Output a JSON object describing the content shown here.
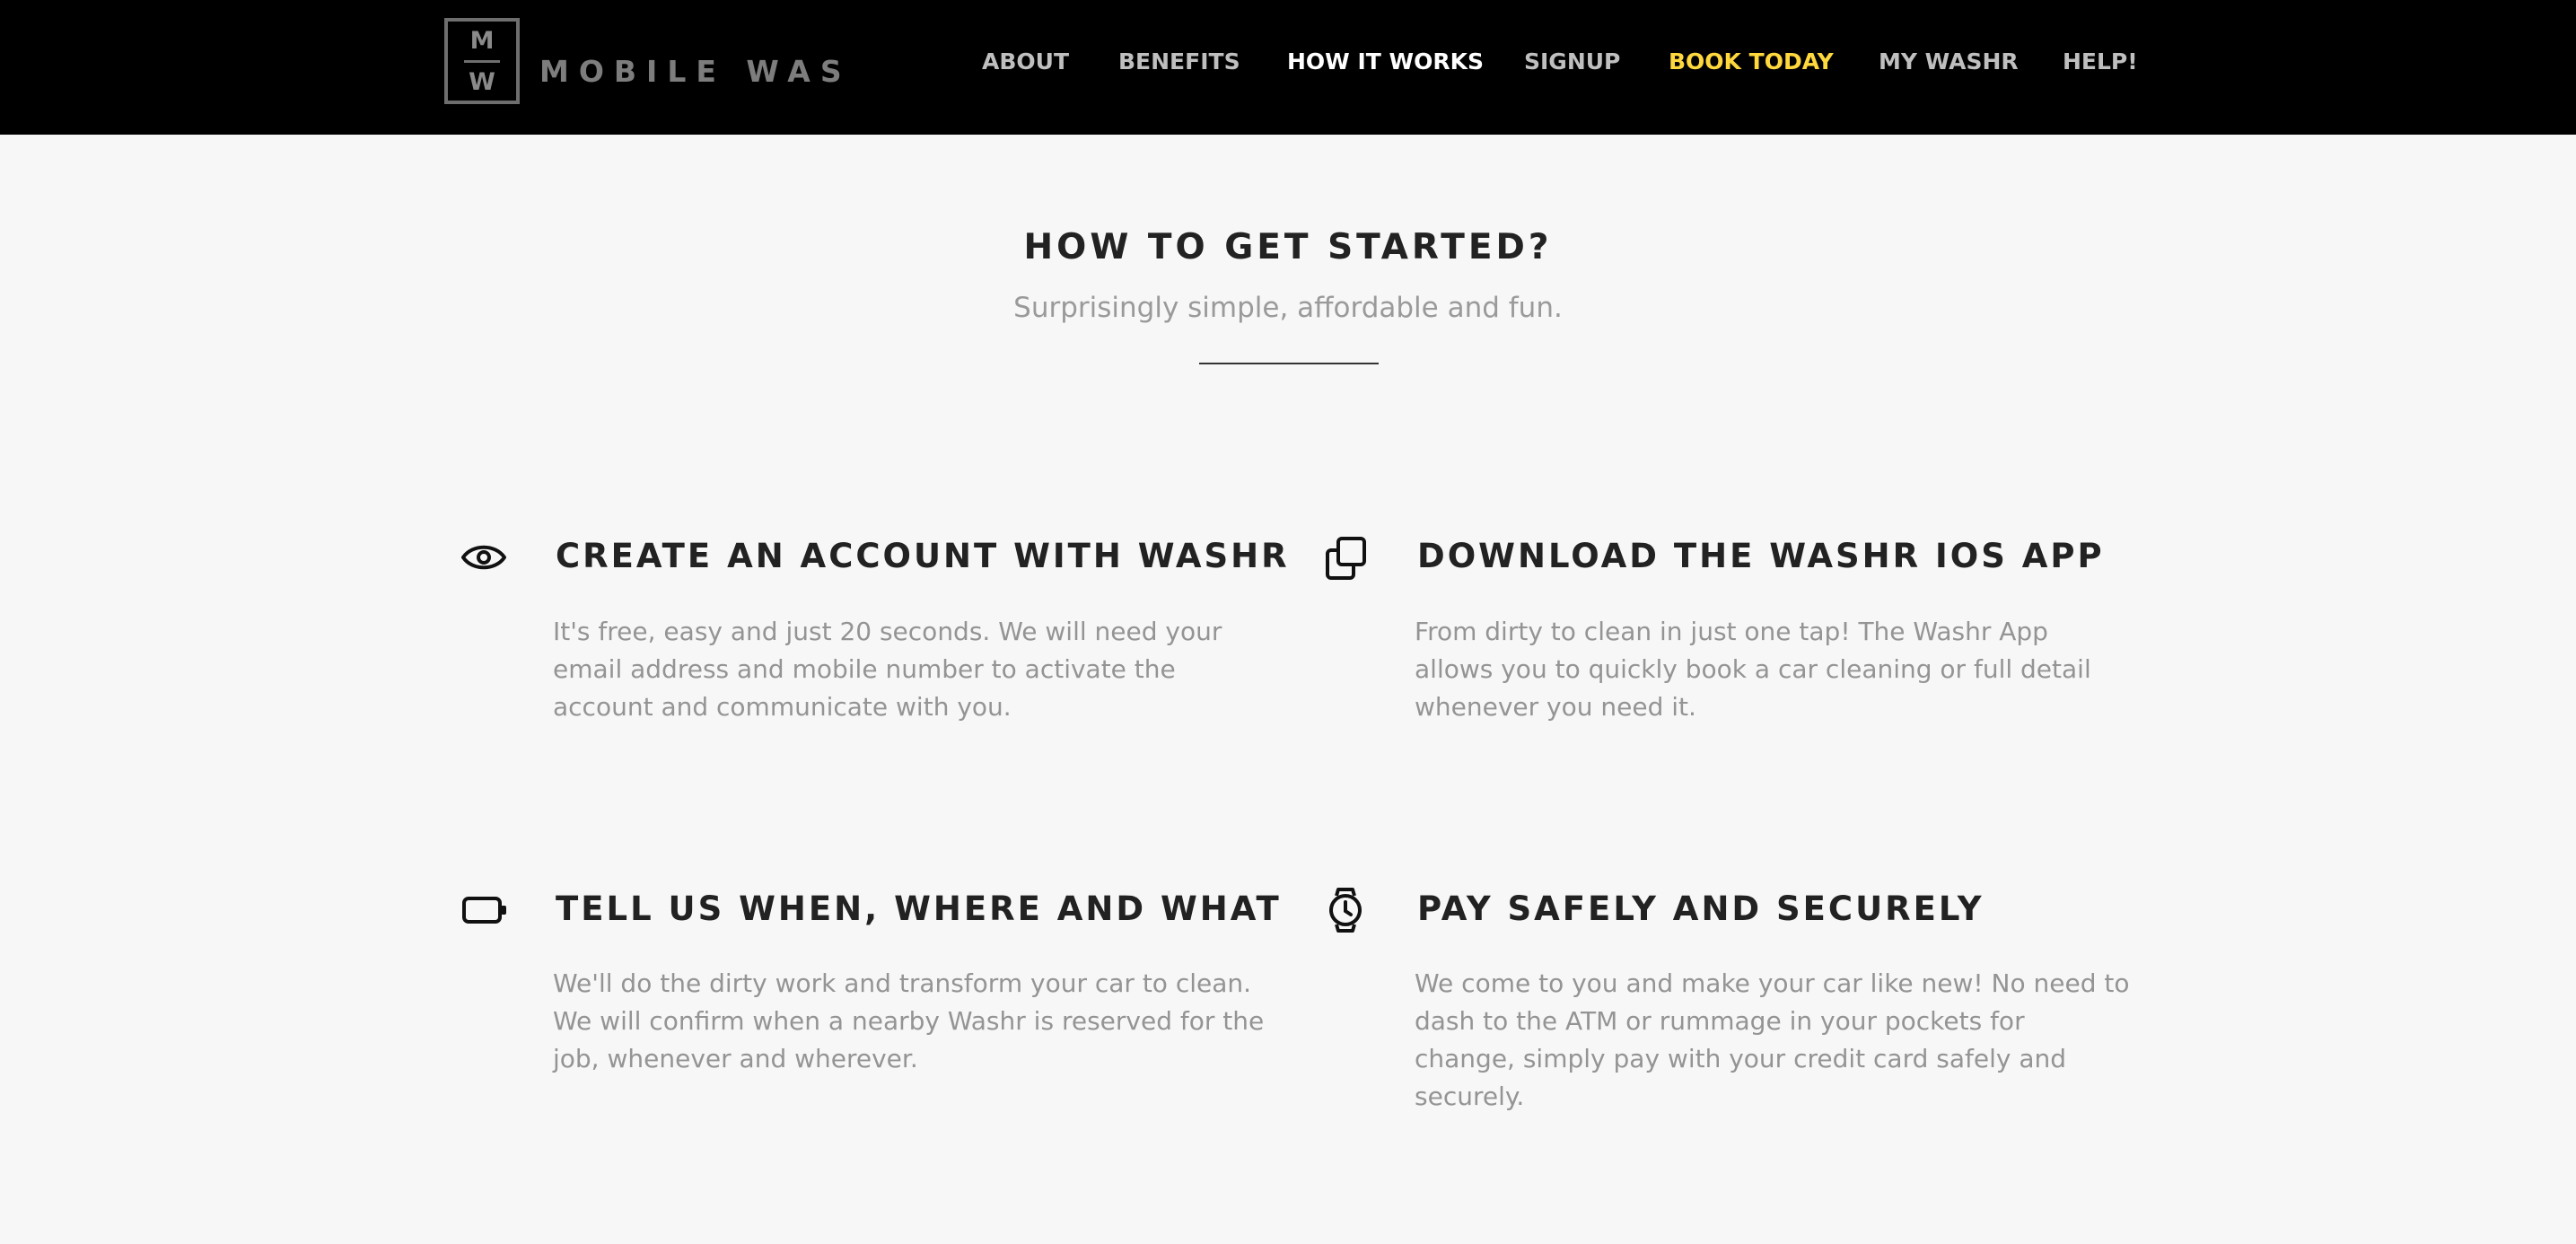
{
  "brand": {
    "logo_top": "M",
    "logo_bottom": "W",
    "name": "MOBILE WAS"
  },
  "nav": {
    "items": [
      {
        "label": "ABOUT"
      },
      {
        "label": "BENEFITS"
      },
      {
        "label": "HOW IT WORKS",
        "state": "active"
      },
      {
        "label": "SIGNUP"
      },
      {
        "label": "BOOK TODAY",
        "state": "highlight"
      },
      {
        "label": "MY WASHR"
      },
      {
        "label": "HELP!"
      }
    ],
    "active_color": "#ffffff",
    "highlight_color": "#ffd83d"
  },
  "section": {
    "title": "HOW TO GET STARTED?",
    "subtitle": "Surprisingly simple, affordable and fun."
  },
  "features": [
    {
      "icon": "eye-icon",
      "title": "CREATE AN ACCOUNT WITH WASHR",
      "text": "It's free, easy and just 20 seconds. We will need your email address and mobile number to activate the account and communicate with you."
    },
    {
      "icon": "copy-icon",
      "title": "DOWNLOAD THE WASHR IOS APP",
      "text": "From dirty to clean in just one tap! The Washr App allows you to quickly book a car cleaning or full detail whenever you need it."
    },
    {
      "icon": "battery-icon",
      "title": "TELL US WHEN, WHERE AND WHAT",
      "text": "We'll do the dirty work and transform your car to clean. We will confirm when a nearby Washr is reserved for the job, whenever and wherever."
    },
    {
      "icon": "watch-icon",
      "title": "PAY SAFELY AND SECURELY",
      "text": "We come to you and make your car like new! No need to dash to the ATM or rummage in your pockets for change, simply pay with your credit card safely and securely."
    }
  ]
}
